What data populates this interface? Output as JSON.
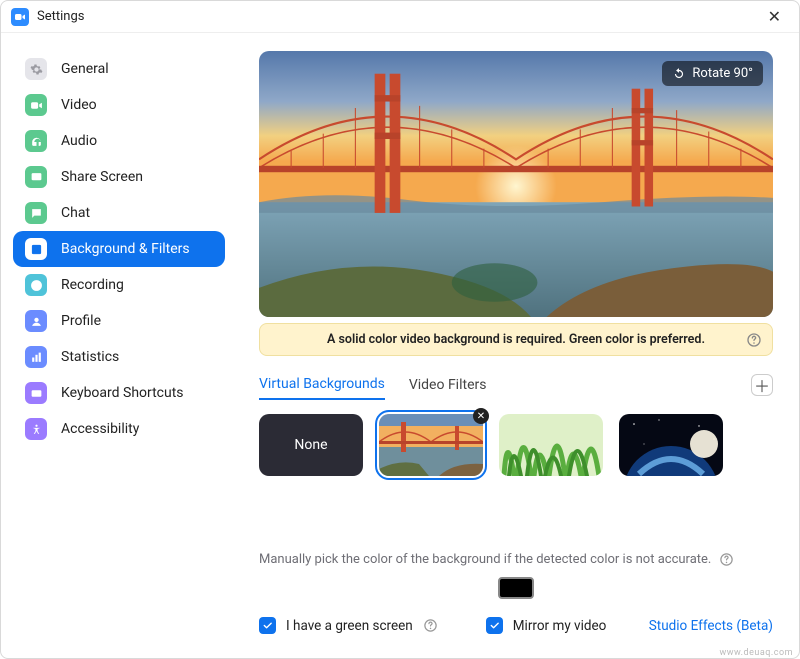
{
  "window": {
    "title": "Settings"
  },
  "sidebar": {
    "items": [
      {
        "label": "General"
      },
      {
        "label": "Video"
      },
      {
        "label": "Audio"
      },
      {
        "label": "Share Screen"
      },
      {
        "label": "Chat"
      },
      {
        "label": "Background & Filters"
      },
      {
        "label": "Recording"
      },
      {
        "label": "Profile"
      },
      {
        "label": "Statistics"
      },
      {
        "label": "Keyboard Shortcuts"
      },
      {
        "label": "Accessibility"
      }
    ],
    "active_index": 5
  },
  "preview": {
    "rotate_label": "Rotate 90°",
    "warning_text": "A solid color video background is required. Green color is preferred."
  },
  "tabs": {
    "items": [
      {
        "label": "Virtual Backgrounds"
      },
      {
        "label": "Video Filters"
      }
    ],
    "active_index": 0
  },
  "thumbnails": {
    "none_label": "None",
    "selected_index": 1,
    "items": [
      {
        "name": "none"
      },
      {
        "name": "bridge-sunset"
      },
      {
        "name": "grass"
      },
      {
        "name": "earth-space"
      }
    ]
  },
  "color_picker": {
    "hint": "Manually pick the color of the background if the detected color is not accurate.",
    "swatch_color": "#000000"
  },
  "options": {
    "green_screen_label": "I have a green screen",
    "green_screen_checked": true,
    "mirror_label": "Mirror my video",
    "mirror_checked": true,
    "studio_link": "Studio Effects (Beta)"
  },
  "watermark": "www.deuaq.com"
}
